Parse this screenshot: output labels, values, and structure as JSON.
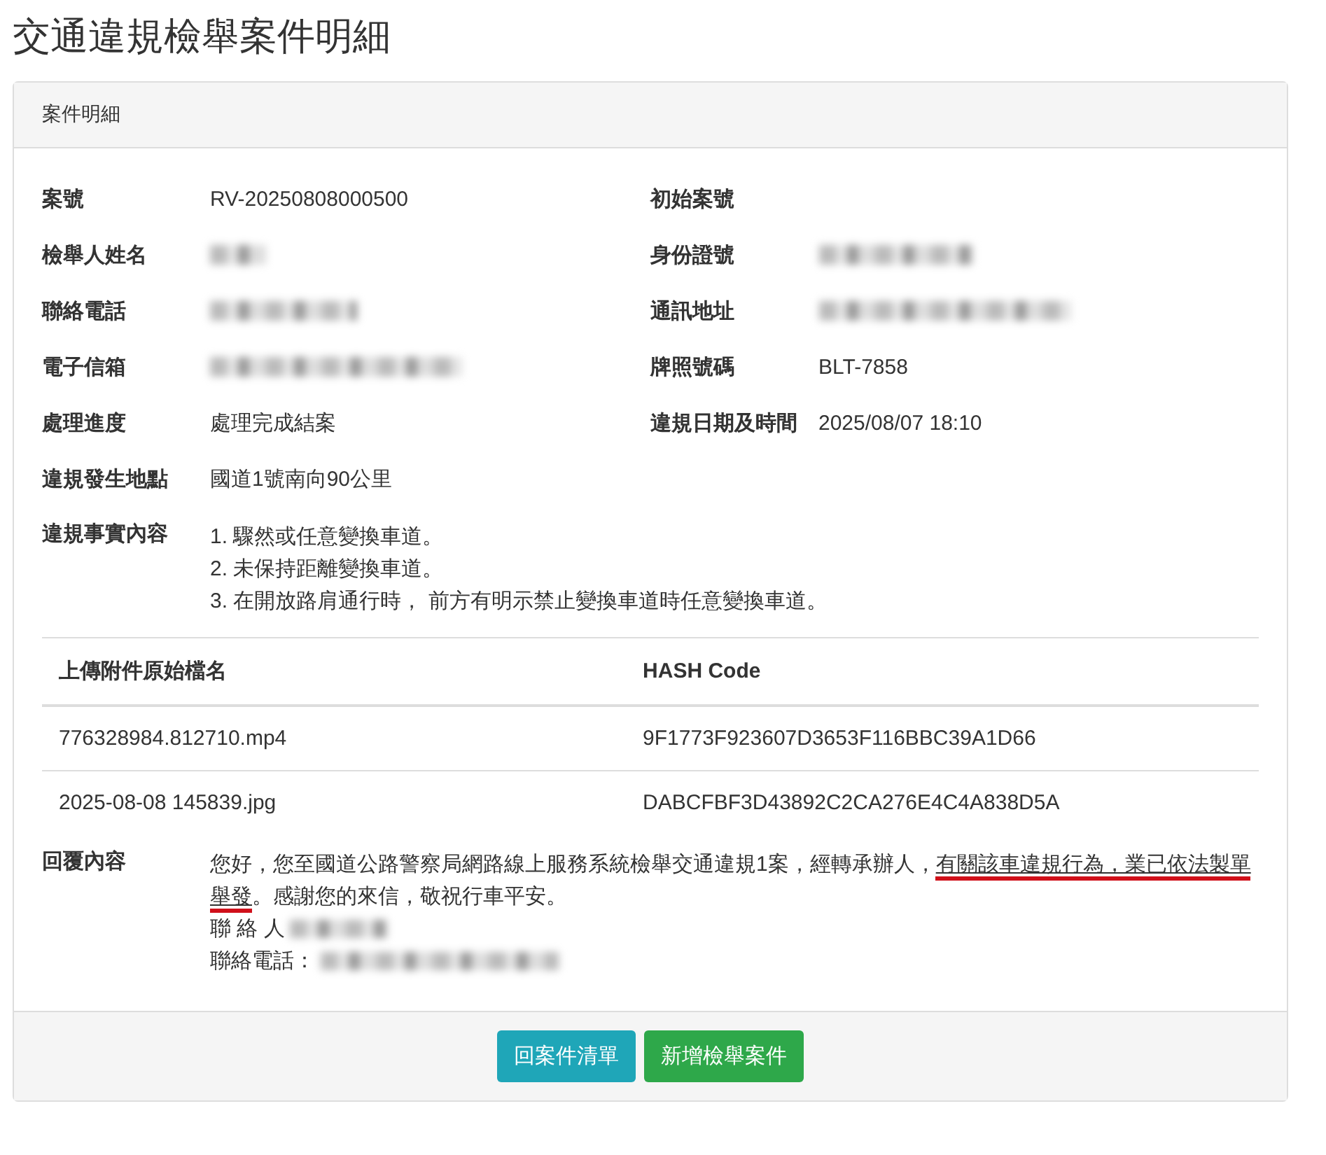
{
  "page_title": "交通違規檢舉案件明細",
  "panel": {
    "title": "案件明細",
    "fields": [
      {
        "label": "案號",
        "kind": "text",
        "value": "RV-20250808000500"
      },
      {
        "label": "初始案號",
        "kind": "empty"
      },
      {
        "label": "檢舉人姓名",
        "kind": "redacted"
      },
      {
        "label": "身份證號",
        "kind": "redacted"
      },
      {
        "label": "聯絡電話",
        "kind": "redacted"
      },
      {
        "label": "通訊地址",
        "kind": "redacted"
      },
      {
        "label": "電子信箱",
        "kind": "redacted"
      },
      {
        "label": "牌照號碼",
        "kind": "text",
        "value": "BLT-7858"
      },
      {
        "label": "處理進度",
        "kind": "text",
        "value": "處理完成結案"
      },
      {
        "label": "違規日期及時間",
        "kind": "text",
        "value": "2025/08/07 18:10"
      },
      {
        "label": "違規發生地點",
        "kind": "text",
        "value": "國道1號南向90公里",
        "wide": true
      }
    ],
    "violation": {
      "label": "違規事實內容",
      "items": [
        "1. 驟然或任意變換車道。",
        "2. 未保持距離變換車道。",
        "3. 在開放路肩通行時， 前方有明示禁止變換車道時任意變換車道。"
      ]
    },
    "attachments": {
      "columns": [
        "上傳附件原始檔名",
        "HASH Code"
      ],
      "rows": [
        [
          "776328984.812710.mp4",
          "9F1773F923607D3653F116BBC39A1D66"
        ],
        [
          "2025-08-08 145839.jpg",
          "DABCFBF3D43892C2CA276E4C4A838D5A"
        ]
      ]
    },
    "reply": {
      "label": "回覆內容",
      "segments": [
        {
          "text": "您好，您至國道公路警察局網路線上服務系統檢舉交通違規1案，經轉承辦人，",
          "highlighted": false
        },
        {
          "text": "有關該車違規行為，業已依法製單舉發",
          "highlighted": true
        },
        {
          "text": "。感謝您的來信，敬祝行車平安。",
          "highlighted": false
        }
      ],
      "contacts": [
        {
          "label": "聯 絡 人",
          "redacted": true
        },
        {
          "label": "聯絡電話：",
          "redacted": true
        }
      ]
    }
  },
  "buttons": [
    {
      "label": "回案件清單",
      "kind": "info"
    },
    {
      "label": "新增檢舉案件",
      "kind": "success"
    }
  ]
}
